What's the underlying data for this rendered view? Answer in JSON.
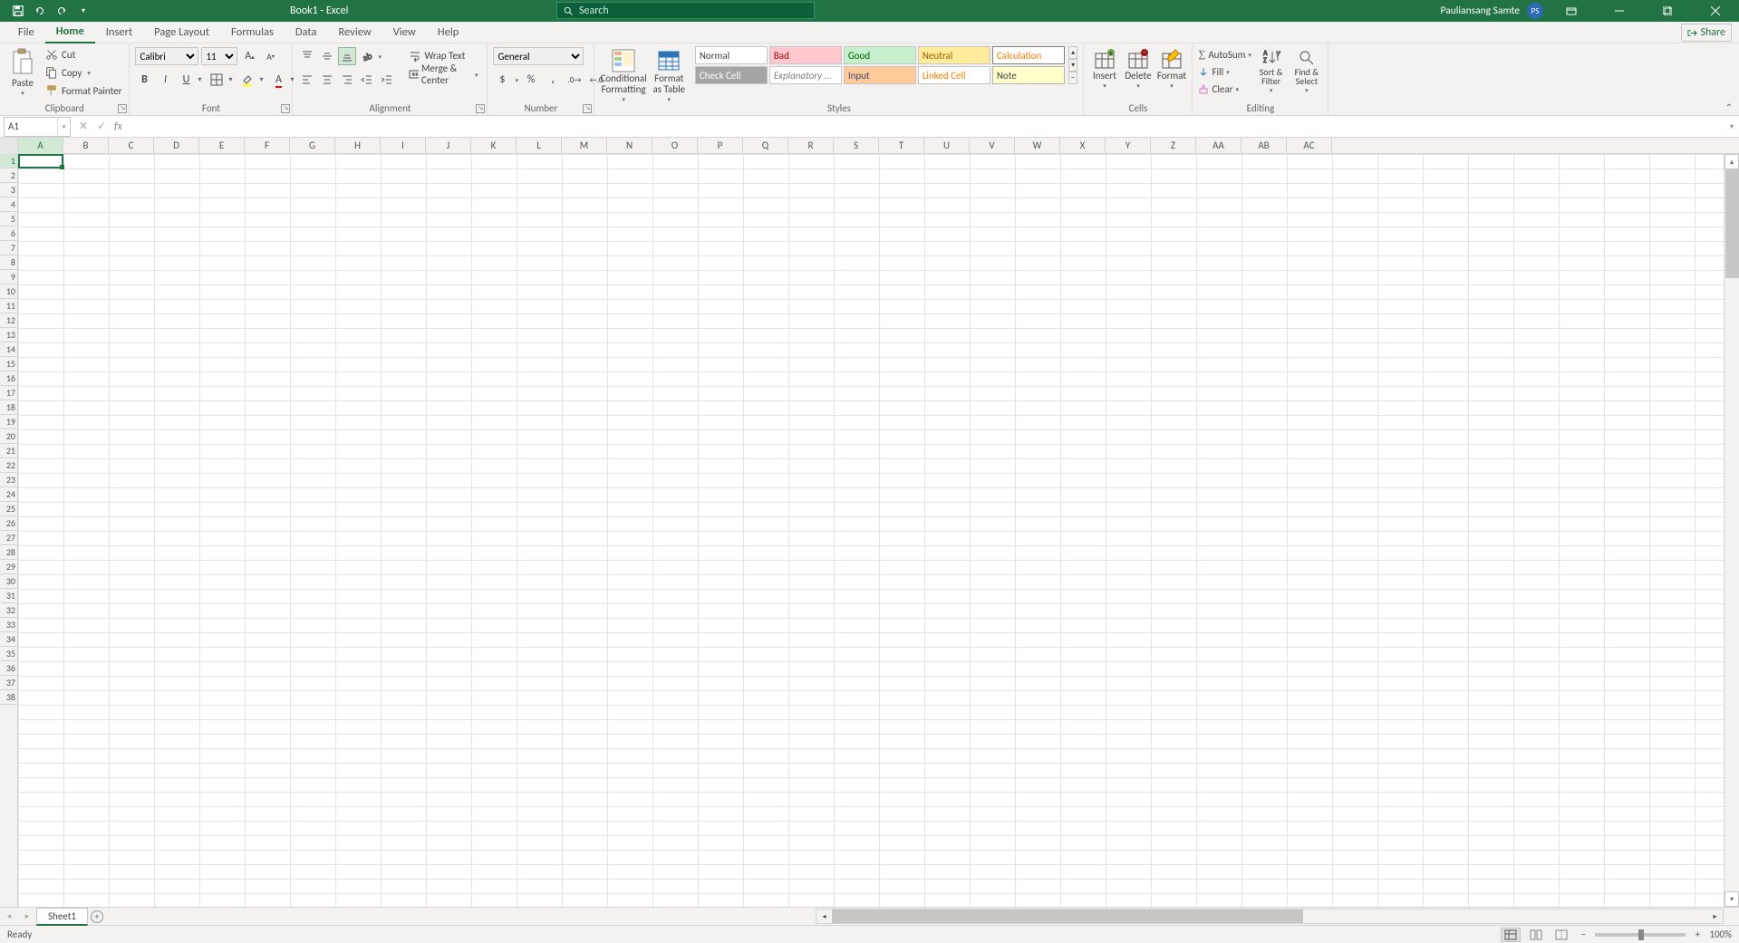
{
  "title_bar": {
    "document_title": "Book1  -  Excel",
    "search_placeholder": "Search",
    "user_name": "Pauliansang Samte",
    "user_initials": "PS"
  },
  "tabs": {
    "file": "File",
    "home": "Home",
    "insert": "Insert",
    "page_layout": "Page Layout",
    "formulas": "Formulas",
    "data": "Data",
    "review": "Review",
    "view": "View",
    "help": "Help",
    "share": "Share"
  },
  "ribbon": {
    "clipboard": {
      "label": "Clipboard",
      "paste": "Paste",
      "cut": "Cut",
      "copy": "Copy",
      "format_painter": "Format Painter"
    },
    "font": {
      "label": "Font",
      "name": "Calibri",
      "size": "11"
    },
    "alignment": {
      "label": "Alignment",
      "wrap": "Wrap Text",
      "merge": "Merge & Center"
    },
    "number": {
      "label": "Number",
      "format": "General"
    },
    "styles": {
      "label": "Styles",
      "cond_fmt": "Conditional Formatting",
      "fmt_table": "Format as Table",
      "normal": "Normal",
      "bad": "Bad",
      "good": "Good",
      "neutral": "Neutral",
      "calculation": "Calculation",
      "check_cell": "Check Cell",
      "explanatory": "Explanatory ...",
      "input": "Input",
      "linked_cell": "Linked Cell",
      "note": "Note"
    },
    "cells": {
      "label": "Cells",
      "insert": "Insert",
      "delete": "Delete",
      "format": "Format"
    },
    "editing": {
      "label": "Editing",
      "autosum": "AutoSum",
      "fill": "Fill",
      "clear": "Clear",
      "sort_filter": "Sort & Filter",
      "find_select": "Find & Select"
    }
  },
  "formula_bar": {
    "cell_ref": "A1",
    "formula": ""
  },
  "grid": {
    "columns": [
      "A",
      "B",
      "C",
      "D",
      "E",
      "F",
      "G",
      "H",
      "I",
      "J",
      "K",
      "L",
      "M",
      "N",
      "O",
      "P",
      "Q",
      "R",
      "S",
      "T",
      "U",
      "V",
      "W",
      "X",
      "Y",
      "Z",
      "AA",
      "AB",
      "AC"
    ],
    "rows": [
      "1",
      "2",
      "3",
      "4",
      "5",
      "6",
      "7",
      "8",
      "9",
      "10",
      "11",
      "12",
      "13",
      "14",
      "15",
      "16",
      "17",
      "18",
      "19",
      "20",
      "21",
      "22",
      "23",
      "24",
      "25",
      "26",
      "27",
      "28",
      "29",
      "30",
      "31",
      "32",
      "33",
      "34",
      "35",
      "36",
      "37",
      "38"
    ],
    "selected_col": "A",
    "selected_row": "1"
  },
  "sheet_bar": {
    "active_sheet": "Sheet1"
  },
  "status_bar": {
    "state": "Ready",
    "zoom": "100%"
  }
}
